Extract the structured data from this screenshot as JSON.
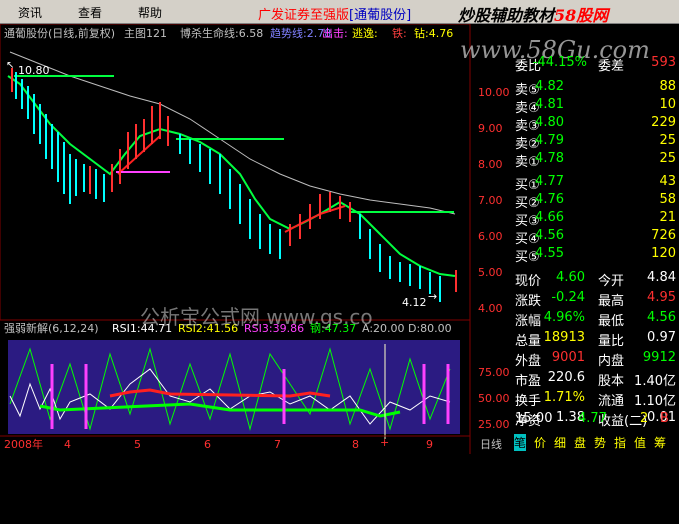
{
  "menu": {
    "items": [
      "资讯",
      "查看",
      "帮助"
    ],
    "title_prefix": "广发证券至强版",
    "title_stock": "[通葡股份]"
  },
  "watermark": {
    "top": "炒股辅助教材",
    "top_accent": "58股网",
    "url": "www.58Gu.com",
    "mid": "公析宝公式网 www.gs.co"
  },
  "main_chart": {
    "stock": "通葡股份(日线,前复权)",
    "label_main": "主图121",
    "lifeline_label": "博杀生命线:6.58",
    "line2_label": "趋势线:2.78",
    "exit_label": "出击:",
    "escape_label": "逃逸:",
    "buy_label": "铁:",
    "grow_label": "钻:4.76",
    "high_label": "10.80",
    "low_label": "4.12"
  },
  "y_axis": [
    "10.00",
    "9.00",
    "8.00",
    "7.00",
    "6.00",
    "5.00",
    "4.00"
  ],
  "sub_chart": {
    "name": "强弱新解(6,12,24)",
    "rsi1": "RSI1:44.71",
    "rsi2": "RSI2:41.56",
    "rsi3": "RSI3:39.86",
    "k": "钢:47.37",
    "a": "A:20.00",
    "d": "D:80.00",
    "y_labels": [
      "75.00",
      "50.00",
      "25.00"
    ]
  },
  "x_axis": [
    "2008年",
    "4",
    "5",
    "6",
    "7",
    "8",
    "9"
  ],
  "x_axis_right": "日线",
  "quote": {
    "bid_ratio_label": "委比",
    "bid_ratio": "-44.15%",
    "bid_diff_label": "委差",
    "bid_diff": "593",
    "sells": [
      {
        "label": "卖⑤",
        "price": "4.82",
        "vol": "88"
      },
      {
        "label": "卖④",
        "price": "4.81",
        "vol": "10"
      },
      {
        "label": "卖③",
        "price": "4.80",
        "vol": "229"
      },
      {
        "label": "卖②",
        "price": "4.79",
        "vol": "25"
      },
      {
        "label": "卖①",
        "price": "4.78",
        "vol": "25"
      }
    ],
    "buys": [
      {
        "label": "买①",
        "price": "4.77",
        "vol": "43"
      },
      {
        "label": "买②",
        "price": "4.76",
        "vol": "58"
      },
      {
        "label": "买③",
        "price": "4.66",
        "vol": "21"
      },
      {
        "label": "买④",
        "price": "4.56",
        "vol": "726"
      },
      {
        "label": "买⑤",
        "price": "4.55",
        "vol": "120"
      }
    ],
    "stats": [
      {
        "l1": "现价",
        "v1": "4.60",
        "c1": "down",
        "l2": "今开",
        "v2": "4.84",
        "c2": "wht"
      },
      {
        "l1": "涨跌",
        "v1": "-0.24",
        "c1": "down",
        "l2": "最高",
        "v2": "4.95",
        "c2": "up"
      },
      {
        "l1": "涨幅",
        "v1": "4.96%",
        "c1": "down",
        "l2": "最低",
        "v2": "4.56",
        "c2": "down"
      },
      {
        "l1": "总量",
        "v1": "18913",
        "c1": "yel",
        "l2": "量比",
        "v2": "0.97",
        "c2": "wht"
      },
      {
        "l1": "外盘",
        "v1": "9001",
        "c1": "up",
        "l2": "内盘",
        "v2": "9912",
        "c2": "down"
      },
      {
        "l1": "市盈",
        "v1": "220.6",
        "c1": "wht",
        "l2": "股本",
        "v2": "1.40亿",
        "c2": "wht"
      },
      {
        "l1": "换手",
        "v1": "1.71%",
        "c1": "yel",
        "l2": "流通",
        "v2": "1.10亿",
        "c2": "wht"
      },
      {
        "l1": "净资",
        "v1": "1.38",
        "c1": "wht",
        "l2": "收益(二)",
        "v2": "0.01",
        "c2": "wht"
      }
    ],
    "tick": {
      "time": "15:00",
      "price": "4.77",
      "vol": "2",
      "side": "B"
    }
  },
  "tabs": [
    "笔",
    "价",
    "细",
    "盘",
    "势",
    "指",
    "值",
    "筹"
  ],
  "colors": {
    "up": "#ff3030",
    "down": "#00ff00",
    "lifeline": "#00ff40",
    "ma": "#c0c0c0",
    "sub_bg": "#2b1b82"
  }
}
